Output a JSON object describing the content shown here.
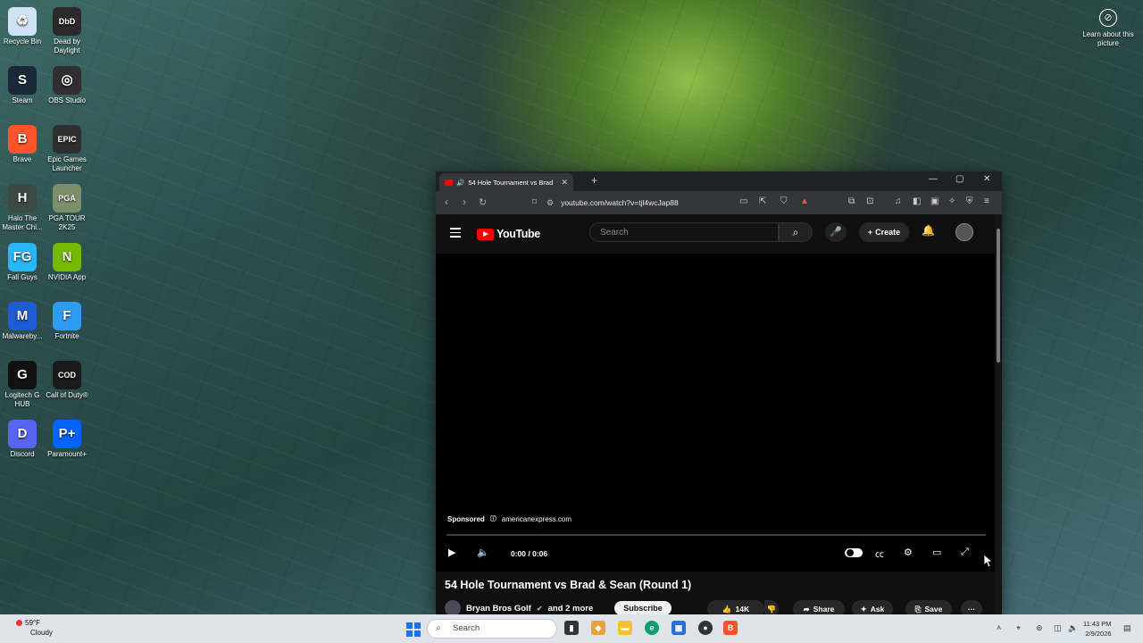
{
  "desktop": {
    "icons": [
      {
        "label": "Recycle Bin",
        "glyph": "♻",
        "color": "#cfe3f7"
      },
      {
        "label": "Dead by Daylight",
        "glyph": "DbD",
        "color": "#2a2a2a"
      },
      {
        "label": "Steam",
        "glyph": "S",
        "color": "#1b2838"
      },
      {
        "label": "OBS Studio",
        "glyph": "◎",
        "color": "#302e31"
      },
      {
        "label": "Brave",
        "glyph": "B",
        "color": "#fb542b"
      },
      {
        "label": "Epic Games Launcher",
        "glyph": "EPIC",
        "color": "#2f2f2f"
      },
      {
        "label": "Halo The Master Chi...",
        "glyph": "H",
        "color": "#3b4a42"
      },
      {
        "label": "PGA TOUR 2K25",
        "glyph": "PGA",
        "color": "#7c8f6a"
      },
      {
        "label": "Fall Guys",
        "glyph": "FG",
        "color": "#29b6f6"
      },
      {
        "label": "NVIDIA App",
        "glyph": "N",
        "color": "#76b900"
      },
      {
        "label": "Malwareby...",
        "glyph": "M",
        "color": "#1e5bd6"
      },
      {
        "label": "Fortnite",
        "glyph": "F",
        "color": "#2e9cf4"
      },
      {
        "label": "Logitech G HUB",
        "glyph": "G",
        "color": "#111111"
      },
      {
        "label": "Call of Duty®",
        "glyph": "COD",
        "color": "#1a1a1a"
      },
      {
        "label": "Discord",
        "glyph": "D",
        "color": "#5865f2"
      },
      {
        "label": "Paramount+",
        "glyph": "P+",
        "color": "#0064ff"
      }
    ],
    "learn_label": "Learn about this picture"
  },
  "browser": {
    "tab_title": "54 Hole Tournament vs Brad",
    "url": "youtube.com/watch?v=tjl4wcJap88"
  },
  "youtube": {
    "logo_text": "YouTube",
    "search_placeholder": "Search",
    "create_label": "Create",
    "sponsored_label": "Sponsored",
    "sponsor_domain": "americanexpress.com",
    "time": "0:00 / 0:06",
    "video_title": "54 Hole Tournament vs Brad & Sean (Round 1)",
    "channel": "Bryan Bros Golf",
    "channel_more": "and 2 more",
    "subscribe_label": "Subscribe",
    "likes": "14K",
    "share_label": "Share",
    "ask_label": "Ask",
    "save_label": "Save",
    "progress": 0.0
  },
  "taskbar": {
    "temperature": "59°F",
    "weather": "Cloudy",
    "search_label": "Search",
    "time": "11:43 PM",
    "date": "2/9/2026"
  },
  "colors": {
    "youtube_red": "#ff0000",
    "player_bg": "#000000",
    "taskbar_bg": "#dfe4ea"
  }
}
